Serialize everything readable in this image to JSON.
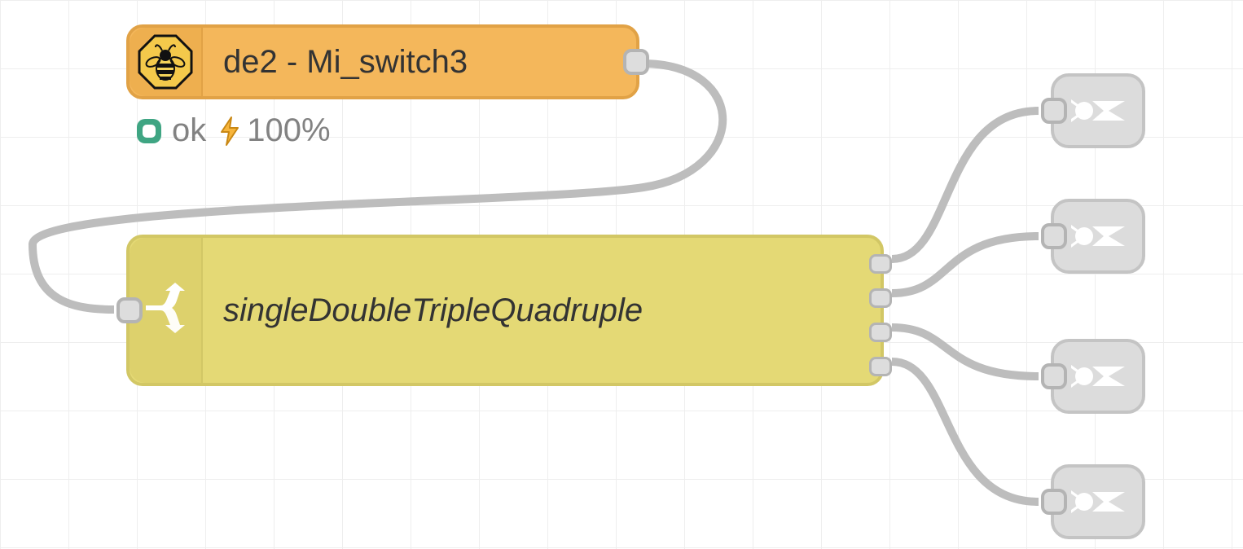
{
  "workspace": {
    "grid_size_px": 84
  },
  "colors": {
    "zigbee_fill": "#f4b75b",
    "zigbee_stroke": "#e1a246",
    "switch_fill": "#e4d975",
    "switch_stroke": "#d2c765",
    "output_fill": "#dcdcdc",
    "output_stroke": "#c4c4c4",
    "wire": "#bdbdbd",
    "port_fill": "#dddddd",
    "port_stroke": "#b4b4b4",
    "status_ok": "#3fa583",
    "bolt": "#f7b53c",
    "bolt_outline": "#c98814"
  },
  "nodes": {
    "zigbee": {
      "label": "de2 - Mi_switch3",
      "icon": "bee-octagon-icon",
      "status": {
        "badge_icon": "square-outline-icon",
        "text": "ok",
        "battery_icon": "bolt-icon",
        "battery": "100%"
      }
    },
    "switch": {
      "label": "singleDoubleTripleQuadruple",
      "icon": "split-icon",
      "outputs": 4
    },
    "outputs": [
      {
        "index": 1,
        "icon": "debug-icon"
      },
      {
        "index": 2,
        "icon": "debug-icon"
      },
      {
        "index": 3,
        "icon": "debug-icon"
      },
      {
        "index": 4,
        "icon": "debug-icon"
      }
    ]
  },
  "connections": [
    {
      "from": "zigbee.out",
      "to": "switch.in"
    },
    {
      "from": "switch.out1",
      "to": "outputs.1.in"
    },
    {
      "from": "switch.out2",
      "to": "outputs.2.in"
    },
    {
      "from": "switch.out3",
      "to": "outputs.3.in"
    },
    {
      "from": "switch.out4",
      "to": "outputs.4.in"
    }
  ]
}
